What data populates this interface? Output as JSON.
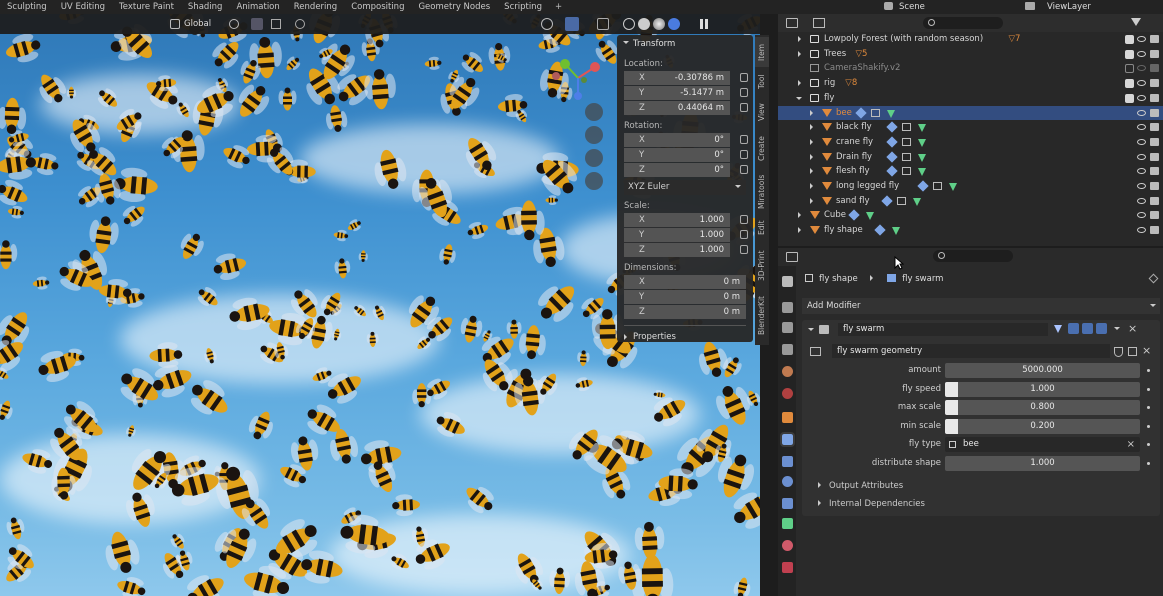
{
  "topbar": {
    "workspaces": [
      "Sculpting",
      "UV Editing",
      "Texture Paint",
      "Shading",
      "Animation",
      "Rendering",
      "Compositing",
      "Geometry Nodes",
      "Scripting"
    ],
    "add_label": "+",
    "scene": "Scene",
    "view_layer": "ViewLayer"
  },
  "viewport": {
    "orientation": "Global"
  },
  "transform": {
    "title": "Transform",
    "location_label": "Location:",
    "location": [
      {
        "axis": "X",
        "value": "-0.30786 m"
      },
      {
        "axis": "Y",
        "value": "-5.1477 m"
      },
      {
        "axis": "Z",
        "value": "0.44064 m"
      }
    ],
    "rotation_label": "Rotation:",
    "rotation": [
      {
        "axis": "X",
        "value": "0°"
      },
      {
        "axis": "Y",
        "value": "0°"
      },
      {
        "axis": "Z",
        "value": "0°"
      }
    ],
    "rotation_mode": "XYZ Euler",
    "scale_label": "Scale:",
    "scale": [
      {
        "axis": "X",
        "value": "1.000"
      },
      {
        "axis": "Y",
        "value": "1.000"
      },
      {
        "axis": "Z",
        "value": "1.000"
      }
    ],
    "dimensions_label": "Dimensions:",
    "dimensions": [
      {
        "axis": "X",
        "value": "0 m"
      },
      {
        "axis": "Y",
        "value": "0 m"
      },
      {
        "axis": "Z",
        "value": "0 m"
      }
    ],
    "properties_label": "Properties"
  },
  "side_tabs": [
    "Item",
    "Tool",
    "View",
    "Create",
    "Miratools",
    "Edit",
    "3D-Print",
    "BlenderKit"
  ],
  "outliner": {
    "rows": [
      {
        "name": "Lowpoly Forest (with random season)",
        "extra": "7"
      },
      {
        "name": "Trees",
        "extra": "5"
      },
      {
        "name": "CameraShakify.v2",
        "extra": ""
      },
      {
        "name": "rig",
        "extra": "8"
      },
      {
        "name": "fly",
        "extra": ""
      },
      {
        "name": "bee",
        "extra": ""
      },
      {
        "name": "black fly",
        "extra": ""
      },
      {
        "name": "crane fly",
        "extra": ""
      },
      {
        "name": "Drain fly",
        "extra": ""
      },
      {
        "name": "flesh fly",
        "extra": ""
      },
      {
        "name": "long legged fly",
        "extra": ""
      },
      {
        "name": "sand fly",
        "extra": ""
      },
      {
        "name": "Cube",
        "extra": ""
      },
      {
        "name": "fly shape",
        "extra": ""
      }
    ]
  },
  "properties": {
    "breadcrumb_object": "fly shape",
    "breadcrumb_modifier": "fly swarm",
    "add_modifier": "Add Modifier",
    "modifier_name": "fly swarm",
    "node_group": "fly swarm geometry",
    "fields": [
      {
        "label": "amount",
        "value": "5000.000"
      },
      {
        "label": "fly speed",
        "value": "1.000"
      },
      {
        "label": "max scale",
        "value": "0.800"
      },
      {
        "label": "min scale",
        "value": "0.200"
      },
      {
        "label": "fly type",
        "value": "bee"
      },
      {
        "label": "distribute shape",
        "value": "1.000"
      }
    ],
    "output_attributes": "Output Attributes",
    "internal_dependencies": "Internal Dependencies"
  },
  "colors": {
    "selected_row": "#334d80",
    "accent_orange": "#e08a3c",
    "mesh_green": "#5fcf88",
    "wrench_blue": "#7fa6e6"
  }
}
